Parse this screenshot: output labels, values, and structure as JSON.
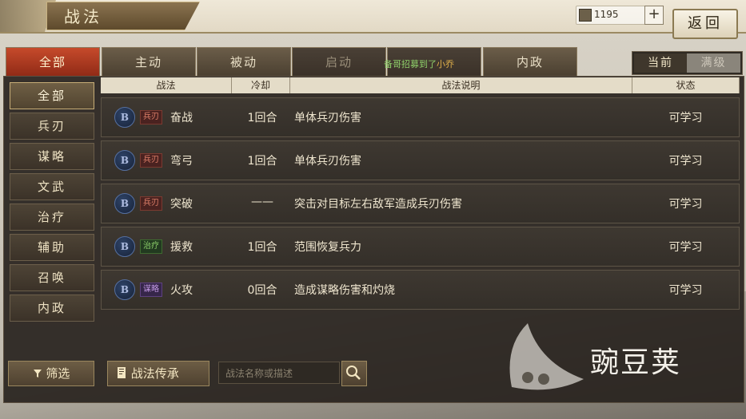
{
  "header": {
    "title": "战法",
    "coins": "1195",
    "plus_label": "+",
    "back_label": "返回"
  },
  "tabs": [
    {
      "label": "全部"
    },
    {
      "label": "主动"
    },
    {
      "label": "被动"
    },
    {
      "label": "启动"
    },
    {
      "label": ""
    },
    {
      "label": "内政"
    }
  ],
  "broadcast": {
    "prefix": "备哥招募到了",
    "name": "小乔"
  },
  "toggle": {
    "current": "当前",
    "max": "满级"
  },
  "sidebar": {
    "items": [
      "全部",
      "兵刃",
      "谋略",
      "文武",
      "治疗",
      "辅助",
      "召唤",
      "内政"
    ]
  },
  "table": {
    "headers": [
      "战法",
      "冷却",
      "战法说明",
      "状态"
    ],
    "rows": [
      {
        "grade": "B",
        "tag": "兵刃",
        "tag_color": "red",
        "name": "奋战",
        "cooldown": "1回合",
        "desc": "单体兵刃伤害",
        "status": "可学习"
      },
      {
        "grade": "B",
        "tag": "兵刃",
        "tag_color": "red",
        "name": "弯弓",
        "cooldown": "1回合",
        "desc": "单体兵刃伤害",
        "status": "可学习"
      },
      {
        "grade": "B",
        "tag": "兵刃",
        "tag_color": "red",
        "name": "突破",
        "cooldown": "——",
        "desc": "突击对目标左右敌军造成兵刃伤害",
        "status": "可学习"
      },
      {
        "grade": "B",
        "tag": "治疗",
        "tag_color": "green",
        "name": "援救",
        "cooldown": "1回合",
        "desc": "范围恢复兵力",
        "status": "可学习"
      },
      {
        "grade": "B",
        "tag": "谋略",
        "tag_color": "purple",
        "name": "火攻",
        "cooldown": "0回合",
        "desc": "造成谋略伤害和灼烧",
        "status": "可学习"
      }
    ]
  },
  "footer": {
    "filter_label": "筛选",
    "inherit_label": "战法传承",
    "search_placeholder": "战法名称或描述"
  },
  "watermark": {
    "text": "豌豆荚"
  },
  "icons": {
    "filter": "filter-icon",
    "inherit": "scroll-icon",
    "search": "search-icon",
    "coin": "coin-icon"
  }
}
